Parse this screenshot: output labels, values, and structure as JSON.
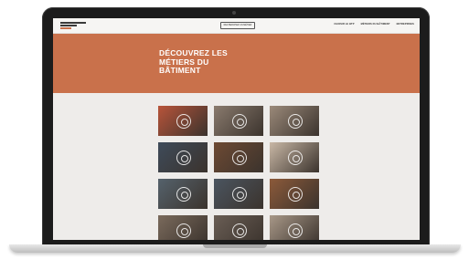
{
  "header": {
    "search_label": "RECHERCHER UN MÉTIER",
    "nav": [
      "CHOISIR LE BTP",
      "MÉTIERS DU BÂTIMENT",
      "ENTREPRISES"
    ]
  },
  "hero": {
    "title_lines": [
      "DÉCOUVREZ LES",
      "MÉTIERS DU",
      "BÂTIMENT"
    ],
    "color": "#c9714b"
  },
  "tiles": [
    {
      "icon": "trade-icon",
      "color": "#b8543a"
    },
    {
      "icon": "trade-icon",
      "color": "#8a7b6e"
    },
    {
      "icon": "trade-icon",
      "color": "#9b8a7a"
    },
    {
      "icon": "trade-icon",
      "color": "#3e4b5a"
    },
    {
      "icon": "trade-icon",
      "color": "#6e4a33"
    },
    {
      "icon": "trade-icon",
      "color": "#c9b8a6"
    },
    {
      "icon": "trade-icon",
      "color": "#55626c"
    },
    {
      "icon": "trade-icon",
      "color": "#4b5560"
    },
    {
      "icon": "trade-icon",
      "color": "#8c5a3a"
    },
    {
      "icon": "trade-icon",
      "color": "#7a6a5c"
    },
    {
      "icon": "trade-icon",
      "color": "#6a5e55"
    },
    {
      "icon": "trade-icon",
      "color": "#a89888"
    }
  ]
}
